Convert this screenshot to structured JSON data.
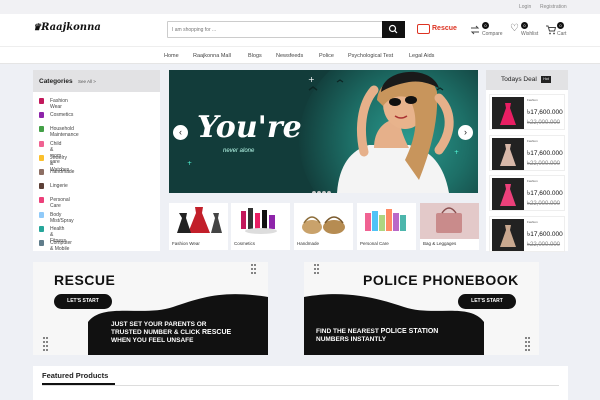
{
  "topbar": {
    "login": "Login",
    "registration": "Registration"
  },
  "header": {
    "logo": "Raajkonna",
    "search_placeholder": "I am shopping for ...",
    "rescue_label": "Rescue",
    "compare_label": "Compare",
    "compare_count": "0",
    "wishlist_label": "Wishlist",
    "wishlist_count": "0",
    "cart_label": "Cart",
    "cart_count": "0"
  },
  "nav": [
    "Home",
    "Raajkonna Mall",
    "Blogs",
    "Newsfeeds",
    "Police",
    "Psychological Test",
    "Legal Aids"
  ],
  "categories": {
    "title": "Categories",
    "see_all": "See All >",
    "items": [
      {
        "label": "Fashion Wear",
        "color": "#c2185b"
      },
      {
        "label": "Cosmetics",
        "color": "#8e24aa"
      },
      {
        "label": "Household Maintenance",
        "color": "#43a047"
      },
      {
        "label": "Child & mom care",
        "color": "#f06292"
      },
      {
        "label": "Jewelry & Watches",
        "color": "#fbc02d"
      },
      {
        "label": "Handmade",
        "color": "#8d6e63"
      },
      {
        "label": "Lingerie",
        "color": "#5d4037"
      },
      {
        "label": "Personal Care",
        "color": "#ec407a"
      },
      {
        "label": "Body Mist/Spray",
        "color": "#90caf9"
      },
      {
        "label": "Health & Fitness",
        "color": "#26a69a"
      },
      {
        "label": "Computer & Mobile",
        "color": "#607d8b"
      }
    ]
  },
  "hero": {
    "headline": "You're",
    "subline": "never alone"
  },
  "tiles": [
    "Fashion Wear",
    "Cosmetics",
    "Handmade",
    "Personal Care",
    "Bag & Leggages"
  ],
  "deal": {
    "title": "Todays Deal",
    "badge": "Hot",
    "items": [
      {
        "name": "Fashion",
        "price": "৳17,600.000",
        "old": "৳22,000.000"
      },
      {
        "name": "Fashion",
        "price": "৳17,600.000",
        "old": "৳22,000.000"
      },
      {
        "name": "Fashion",
        "price": "৳17,600.000",
        "old": "৳22,000.000"
      },
      {
        "name": "Fashion",
        "price": "৳17,600.000",
        "old": "৳22,000.000"
      }
    ]
  },
  "rescue_banner": {
    "title": "RESCUE",
    "button": "LET'S START",
    "line1": "JUST SET YOUR PARENTS OR",
    "line2_a": "TRUSTED NUMBER & CLICK ",
    "line2_b": "RESCUE",
    "line3": "WHEN YOU FEEL UNSAFE"
  },
  "police_banner": {
    "title": "POLICE PHONEBOOK",
    "button": "LET'S START",
    "line1_a": "FIND THE NEAREST ",
    "line1_b": "POLICE STATION",
    "line2": "NUMBERS INSTANTLY"
  },
  "featured": {
    "title": "Featured Products"
  }
}
